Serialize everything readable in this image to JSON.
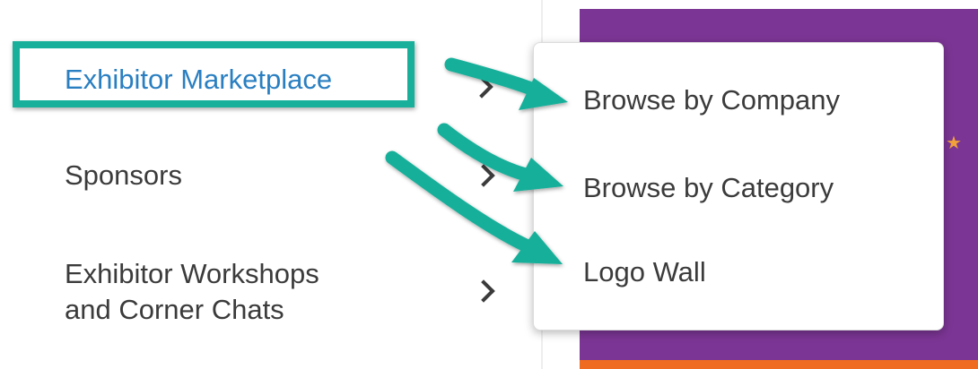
{
  "menu": {
    "items": [
      {
        "label": "Exhibitor Marketplace"
      },
      {
        "label": "Sponsors"
      },
      {
        "label_line1": "Exhibitor Workshops",
        "label_line2": "and Corner Chats"
      }
    ]
  },
  "submenu": {
    "items": [
      {
        "label": "Browse by Company"
      },
      {
        "label": "Browse by Category"
      },
      {
        "label": "Logo Wall"
      }
    ]
  },
  "annotation": {
    "highlight_color": "#18b09a",
    "arrow_color": "#18b09a"
  },
  "colors": {
    "active_link": "#2a7fc1",
    "text": "#3b3b3b",
    "panel_purple": "#7b3594",
    "panel_orange": "#ef6b21",
    "star": "#f2a23a"
  },
  "icons": [
    "chevron-right-icon",
    "star-icon"
  ]
}
